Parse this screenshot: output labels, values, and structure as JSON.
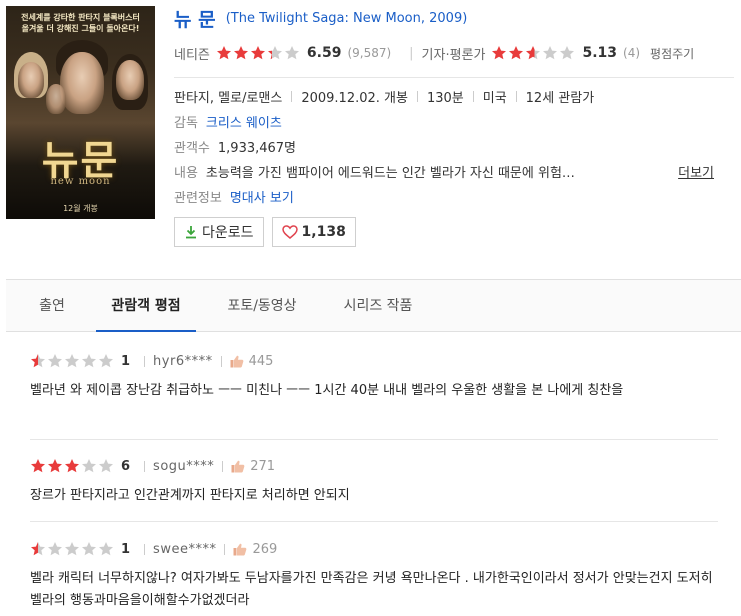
{
  "poster": {
    "tagline_1": "전세계를 강타한 판타지 블록버스터",
    "tagline_2": "올겨울 더 강해진 그들이 돌아온다!",
    "title_ko": "뉴문",
    "title_en": "new moon",
    "release": "12월 개봉"
  },
  "movie": {
    "title_ko": "뉴 문",
    "title_en": "(The Twilight Saga: New Moon, 2009)"
  },
  "ratings": {
    "netizen_label": "네티즌",
    "netizen_stars": 3.3,
    "netizen_score": "6.59",
    "netizen_count": "(9,587)",
    "critic_label": "기자·평론가",
    "critic_stars": 2.6,
    "critic_score": "5.13",
    "critic_count": "(4)",
    "rate_link": "평점주기"
  },
  "meta": {
    "genre": "판타지, 멜로/로맨스",
    "release": "2009.12.02. 개봉",
    "runtime": "130분",
    "country": "미국",
    "age": "12세 관람가",
    "director_label": "감독",
    "director": "크리스 웨이츠",
    "audience_label": "관객수",
    "audience": "1,933,467명",
    "plot_label": "내용",
    "plot": "초능력을 가진 뱀파이어 에드워드는 인간 벨라가 자신 때문에 위험…",
    "more": "더보기",
    "related_label": "관련정보",
    "related": "명대사 보기"
  },
  "buttons": {
    "download": "다운로드",
    "like_count": "1,138"
  },
  "tabs": [
    {
      "label": "출연"
    },
    {
      "label": "관람객 평점"
    },
    {
      "label": "포토/동영상"
    },
    {
      "label": "시리즈 작품"
    }
  ],
  "reviews": [
    {
      "stars": 0.5,
      "score": "1",
      "user": "hyr6****",
      "likes": "445",
      "text": "벨라년 와 제이콥 장난감 취급하노 ㅡㅡ 미친나 ㅡㅡ 1시간 40분 내내 벨라의 우울한 생활을 본 나에게 칭찬을"
    },
    {
      "stars": 3,
      "score": "6",
      "user": "sogu****",
      "likes": "271",
      "text": "장르가 판타지라고 인간관계까지 판타지로 처리하면 안되지"
    },
    {
      "stars": 0.5,
      "score": "1",
      "user": "swee****",
      "likes": "269",
      "text": "벨라 캐릭터 너무하지않나? 여자가봐도 두남자를가진 만족감은 커녕 욕만나온다 . 내가한국인이라서 정서가 안맞는건지 도저히 벨라의 행동과마음을이해할수가없겠더라"
    }
  ],
  "colors": {
    "star_on": "#e83b3b",
    "star_off": "#cccccc",
    "link": "#1a5ec7",
    "tab_active": "#1a5ec7"
  }
}
